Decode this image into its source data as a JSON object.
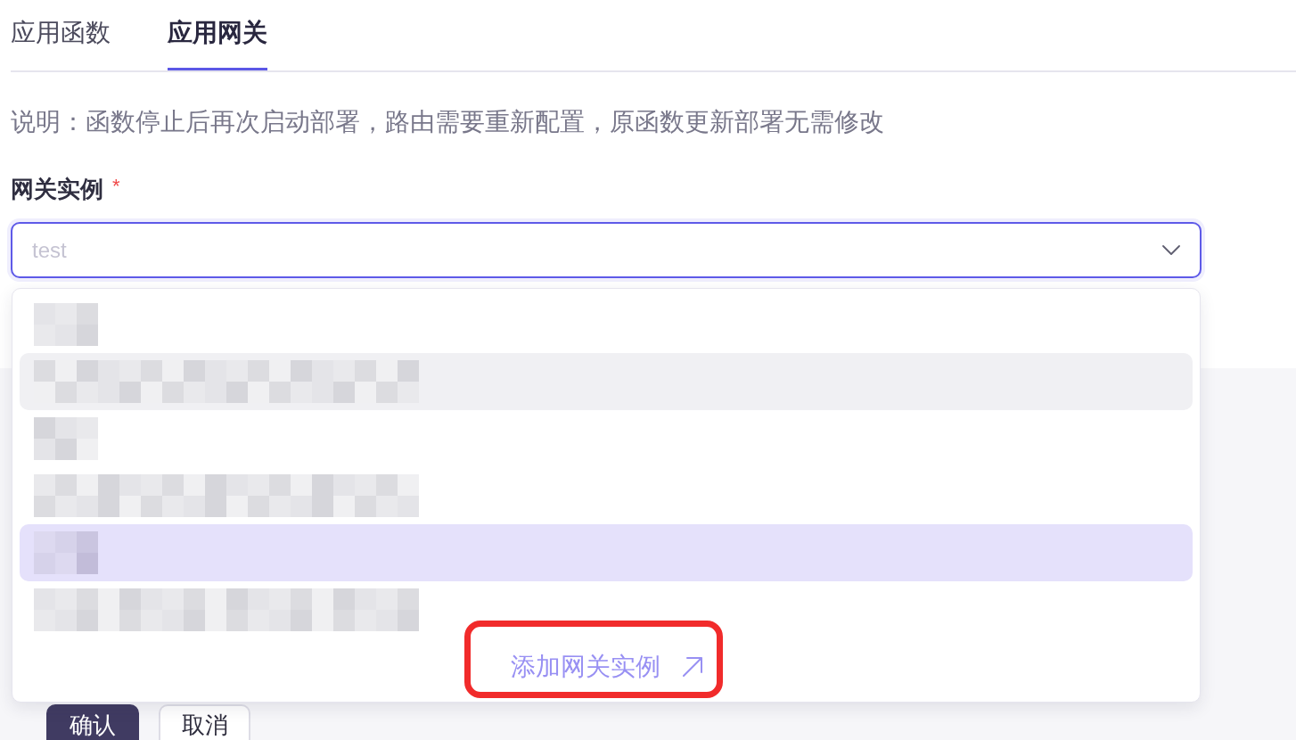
{
  "tabs": [
    {
      "label": "应用函数",
      "selected": false
    },
    {
      "label": "应用网关",
      "selected": true
    }
  ],
  "note": "说明：函数停止后再次启动部署，路由需要重新配置，原函数更新部署无需修改",
  "gateway_select": {
    "label": "网关实例",
    "required_mark": "*",
    "placeholder": "test",
    "focused": true,
    "expanded": true,
    "options": [
      {
        "kind": "short",
        "selected": false,
        "hovered": false
      },
      {
        "kind": "long",
        "selected": false,
        "hovered": true
      },
      {
        "kind": "short",
        "selected": false,
        "hovered": false
      },
      {
        "kind": "long",
        "selected": false,
        "hovered": false
      },
      {
        "kind": "short",
        "selected": true,
        "hovered": false
      },
      {
        "kind": "long",
        "selected": false,
        "hovered": false
      }
    ],
    "add_link": {
      "label": "添加网关实例",
      "annotated": true
    }
  },
  "buttons": [
    {
      "label": "确认",
      "kind": "primary"
    },
    {
      "label": "取消",
      "kind": "secondary"
    }
  ]
}
